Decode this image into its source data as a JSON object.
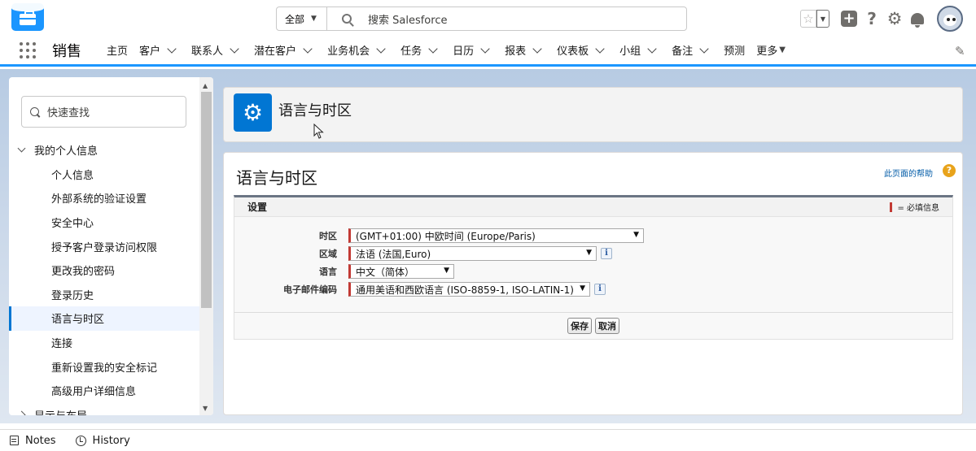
{
  "header": {
    "search_scope": "全部",
    "search_placeholder": "搜索 Salesforce",
    "star_glyph": "☆"
  },
  "nav": {
    "app_name": "销售",
    "items": [
      {
        "label": "主页",
        "menu": false
      },
      {
        "label": "客户",
        "menu": true
      },
      {
        "label": "联系人",
        "menu": true
      },
      {
        "label": "潜在客户",
        "menu": true
      },
      {
        "label": "业务机会",
        "menu": true
      },
      {
        "label": "任务",
        "menu": true
      },
      {
        "label": "日历",
        "menu": true
      },
      {
        "label": "报表",
        "menu": true
      },
      {
        "label": "仪表板",
        "menu": true
      },
      {
        "label": "小组",
        "menu": true
      },
      {
        "label": "备注",
        "menu": true
      },
      {
        "label": "预测",
        "menu": false
      }
    ],
    "more_label": "更多"
  },
  "sidebar": {
    "quick_find_placeholder": "快速查找",
    "section_label": "我的个人信息",
    "items": [
      {
        "label": "个人信息",
        "active": false
      },
      {
        "label": "外部系统的验证设置",
        "active": false
      },
      {
        "label": "安全中心",
        "active": false
      },
      {
        "label": "授予客户登录访问权限",
        "active": false
      },
      {
        "label": "更改我的密码",
        "active": false
      },
      {
        "label": "登录历史",
        "active": false
      },
      {
        "label": "语言与时区",
        "active": true
      },
      {
        "label": "连接",
        "active": false
      },
      {
        "label": "重新设置我的安全标记",
        "active": false
      },
      {
        "label": "高级用户详细信息",
        "active": false
      }
    ],
    "next_section_label": "显示与布局"
  },
  "page_header": {
    "title": "语言与时区"
  },
  "main": {
    "title": "语言与时区",
    "help_link": "此页面的帮助",
    "section_title": "设置",
    "required_legend": "= 必填信息",
    "fields": [
      {
        "label": "时区",
        "value": "(GMT+01:00) 中欧时间 (Europe/Paris)",
        "info": false
      },
      {
        "label": "区域",
        "value": "法语 (法国,Euro)",
        "info": true
      },
      {
        "label": "语言",
        "value": "中文（简体）",
        "info": false
      },
      {
        "label": "电子邮件编码",
        "value": "通用美语和西欧语言 (ISO-8859-1, ISO-LATIN-1)",
        "info": true
      }
    ],
    "save_label": "保存",
    "cancel_label": "取消"
  },
  "utility": {
    "notes_label": "Notes",
    "history_label": "History"
  },
  "colors": {
    "brand": "#1b96ff",
    "icon_tile": "#0176d3",
    "required": "#c23934",
    "help_badge": "#e8a31b"
  }
}
